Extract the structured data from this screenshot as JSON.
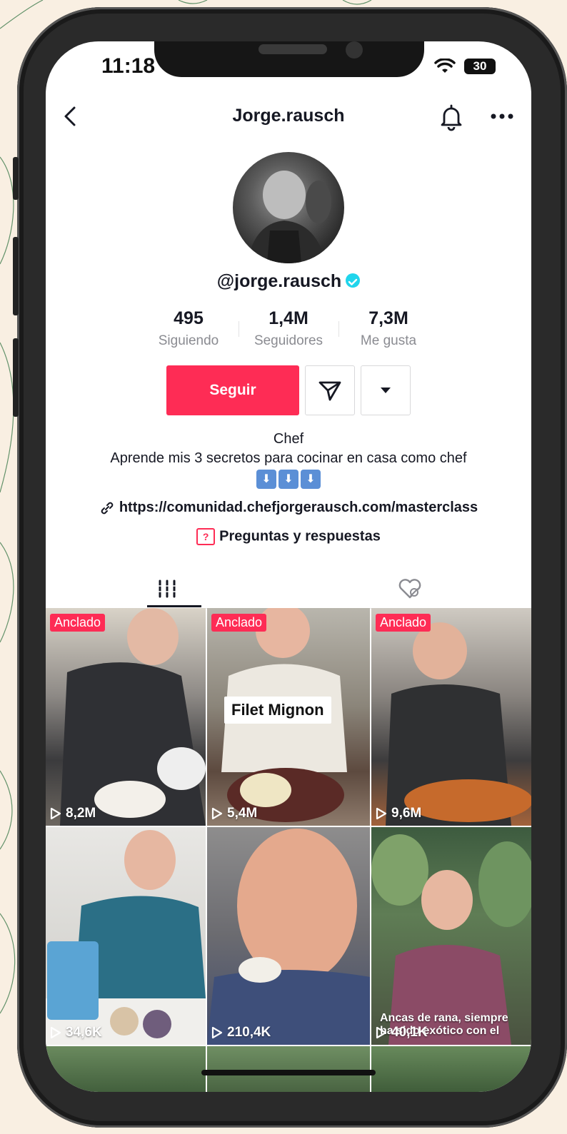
{
  "status_bar": {
    "time": "11:18",
    "battery": "30"
  },
  "header": {
    "title": "Jorge.rausch"
  },
  "profile": {
    "username": "@jorge.rausch",
    "stats": [
      {
        "value": "495",
        "label": "Siguiendo"
      },
      {
        "value": "1,4M",
        "label": "Seguidores"
      },
      {
        "value": "7,3M",
        "label": "Me gusta"
      }
    ],
    "follow_label": "Seguir",
    "bio_title": "Chef",
    "bio_text": "Aprende mis 3 secretos para cocinar en casa como chef",
    "bio_emoji": [
      "⬇",
      "⬇",
      "⬇"
    ],
    "link": "https://comunidad.chefjorgerausch.com/masterclass",
    "qa_label": "Preguntas y respuestas"
  },
  "videos": [
    {
      "pinned_label": "Anclado",
      "views": "8,2M"
    },
    {
      "pinned_label": "Anclado",
      "views": "5,4M",
      "overlay": "Filet Mignon"
    },
    {
      "pinned_label": "Anclado",
      "views": "9,6M"
    },
    {
      "views": "34,6K"
    },
    {
      "views": "210,4K"
    },
    {
      "views": "40,1K",
      "caption": "Ancas de rana, siempre ha sido exótico con el"
    }
  ],
  "colors": {
    "accent": "#fe2c55",
    "verified": "#20d5ec"
  }
}
